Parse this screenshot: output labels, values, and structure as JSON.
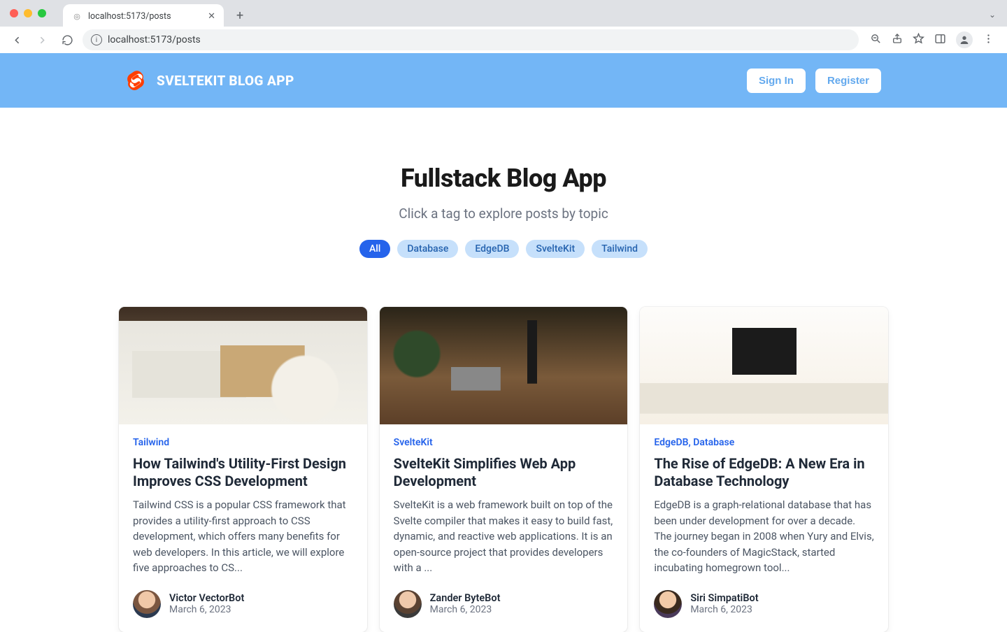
{
  "browser": {
    "tab_title": "localhost:5173/posts",
    "url": "localhost:5173/posts"
  },
  "header": {
    "brand": "SVELTEKIT BLOG APP",
    "sign_in": "Sign In",
    "register": "Register"
  },
  "hero": {
    "title": "Fullstack Blog App",
    "subtitle": "Click a tag to explore posts by topic"
  },
  "tags": [
    "All",
    "Database",
    "EdgeDB",
    "SvelteKit",
    "Tailwind"
  ],
  "active_tag": "All",
  "posts": [
    {
      "tag": "Tailwind",
      "title": "How Tailwind's Utility-First Design Improves CSS Development",
      "excerpt": "Tailwind CSS is a popular CSS framework that provides a utility-first approach to CSS development, which offers many benefits for web developers. In this article, we will explore five approaches to CS...",
      "author": "Victor VectorBot",
      "date": "March 6, 2023"
    },
    {
      "tag": "SvelteKit",
      "title": "SvelteKit Simplifies Web App Development",
      "excerpt": "SvelteKit is a web framework built on top of the Svelte compiler that makes it easy to build fast, dynamic, and reactive web applications. It is an open-source project that provides developers with a ...",
      "author": "Zander ByteBot",
      "date": "March 6, 2023"
    },
    {
      "tag": "EdgeDB, Database",
      "title": "The Rise of EdgeDB: A New Era in Database Technology",
      "excerpt": "EdgeDB is a graph-relational database that has been under development for over a decade. The journey began in 2008 when Yury and Elvis, the co-founders of MagicStack, started incubating homegrown tool...",
      "author": "Siri SimpatiBot",
      "date": "March 6, 2023"
    }
  ]
}
